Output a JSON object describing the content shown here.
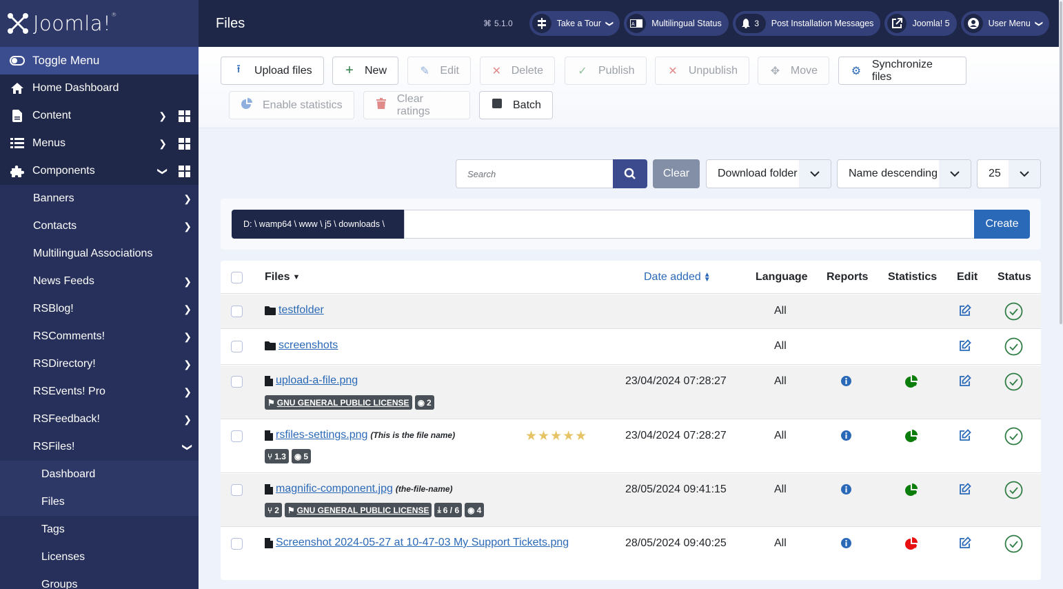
{
  "app": {
    "brand": "Joomla!",
    "version": "5.1.0"
  },
  "header": {
    "title": "Files",
    "pills": [
      {
        "label": "Take a Tour",
        "icon": "signpost-icon",
        "has_dropdown": true
      },
      {
        "label": "Multilingual Status",
        "icon": "language-icon"
      },
      {
        "label": "Post Installation Messages",
        "icon": "bell-icon",
        "count": "3"
      },
      {
        "label": "Joomla! 5",
        "icon": "external-link-icon"
      },
      {
        "label": "User Menu",
        "icon": "user-icon",
        "has_dropdown": true
      }
    ]
  },
  "sidebar": {
    "toggle": "Toggle Menu",
    "items": [
      {
        "label": "Home Dashboard"
      },
      {
        "label": "Content"
      },
      {
        "label": "Menus"
      },
      {
        "label": "Components"
      }
    ],
    "components": [
      {
        "label": "Banners",
        "has_children": true
      },
      {
        "label": "Contacts",
        "has_children": true
      },
      {
        "label": "Multilingual Associations",
        "has_children": false
      },
      {
        "label": "News Feeds",
        "has_children": true
      },
      {
        "label": "RSBlog!",
        "has_children": true
      },
      {
        "label": "RSComments!",
        "has_children": true
      },
      {
        "label": "RSDirectory!",
        "has_children": true
      },
      {
        "label": "RSEvents! Pro",
        "has_children": true
      },
      {
        "label": "RSFeedback!",
        "has_children": true
      },
      {
        "label": "RSFiles!",
        "expanded": true
      }
    ],
    "rsfiles": [
      {
        "label": "Dashboard"
      },
      {
        "label": "Files",
        "active": true
      },
      {
        "label": "Tags"
      },
      {
        "label": "Licenses"
      },
      {
        "label": "Groups"
      }
    ]
  },
  "toolbar": {
    "upload": "Upload files",
    "new": "New",
    "edit": "Edit",
    "delete": "Delete",
    "publish": "Publish",
    "unpublish": "Unpublish",
    "move": "Move",
    "sync": "Synchronize files",
    "enable_stats": "Enable statistics",
    "clear_ratings": "Clear ratings",
    "batch": "Batch"
  },
  "filters": {
    "search_placeholder": "Search",
    "clear": "Clear",
    "folder": "Download folder",
    "ordering": "Name descending",
    "limit": "25"
  },
  "path": {
    "current": "D: \\ wamp64 \\ www \\ j5 \\ downloads \\",
    "new_folder_value": "",
    "create": "Create"
  },
  "table": {
    "headers": {
      "files": "Files",
      "date": "Date added",
      "language": "Language",
      "reports": "Reports",
      "statistics": "Statistics",
      "edit": "Edit",
      "status": "Status"
    },
    "rows": [
      {
        "type": "folder",
        "name": "testfolder",
        "date": "",
        "language": "All",
        "status": "published"
      },
      {
        "type": "folder",
        "name": "screenshots",
        "date": "",
        "language": "All",
        "status": "published"
      },
      {
        "type": "file",
        "name": "upload-a-file.png",
        "date": "23/04/2024 07:28:27",
        "language": "All",
        "license": "GNU GENERAL PUBLIC LICENSE",
        "views": "2",
        "stats_color": "#0a7d0a",
        "status": "published"
      },
      {
        "type": "file",
        "name": "rsfiles-settings.png",
        "title": "(This is the file name)",
        "rating": 5,
        "date": "23/04/2024 07:28:27",
        "language": "All",
        "version": "1.3",
        "views": "5",
        "stats_color": "#0a7d0a",
        "status": "published"
      },
      {
        "type": "file",
        "name": "magnific-component.jpg",
        "title": "(the-file-name)",
        "date": "28/05/2024 09:41:15",
        "language": "All",
        "version": "2",
        "license": "GNU GENERAL PUBLIC LICENSE",
        "downloads": "6 / 6",
        "views": "4",
        "stats_color": "#0a7d0a",
        "status": "published"
      },
      {
        "type": "file",
        "name": "Screenshot 2024-05-27 at 10-47-03 My Support Tickets.png",
        "date": "28/05/2024 09:40:25",
        "language": "All",
        "stats_color": "#e81010",
        "status": "published"
      }
    ]
  },
  "colors": {
    "sidebar": "#20284a",
    "header": "#1f2749",
    "accent": "#2a69b8",
    "status_green": "#2f7d45"
  }
}
